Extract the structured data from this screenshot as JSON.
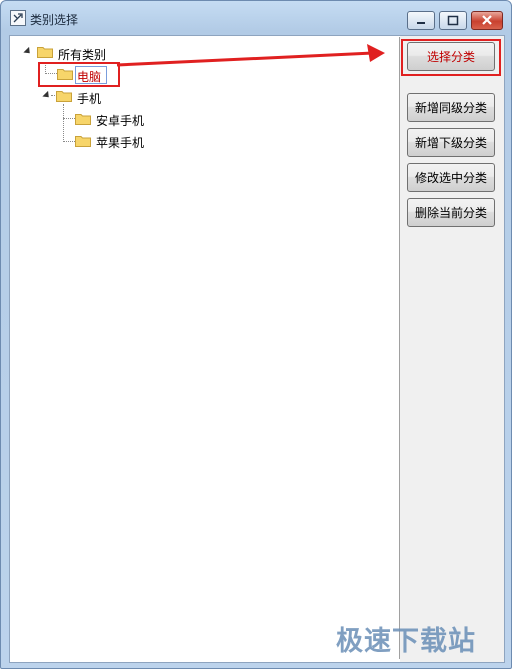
{
  "window": {
    "title": "类别选择"
  },
  "tree": {
    "nodes": [
      {
        "label": "所有类别",
        "expanded": true
      },
      {
        "label": "电脑",
        "selected": true
      },
      {
        "label": "手机",
        "expanded": true
      },
      {
        "label": "安卓手机"
      },
      {
        "label": "苹果手机"
      }
    ]
  },
  "buttons": {
    "select": "选择分类",
    "add_sibling": "新增同级分类",
    "add_child": "新增下级分类",
    "edit_selected": "修改选中分类",
    "delete_current": "删除当前分类"
  },
  "colors": {
    "highlight": "#e02020",
    "selected_text": "#c00000"
  },
  "watermark": "极速下载站"
}
